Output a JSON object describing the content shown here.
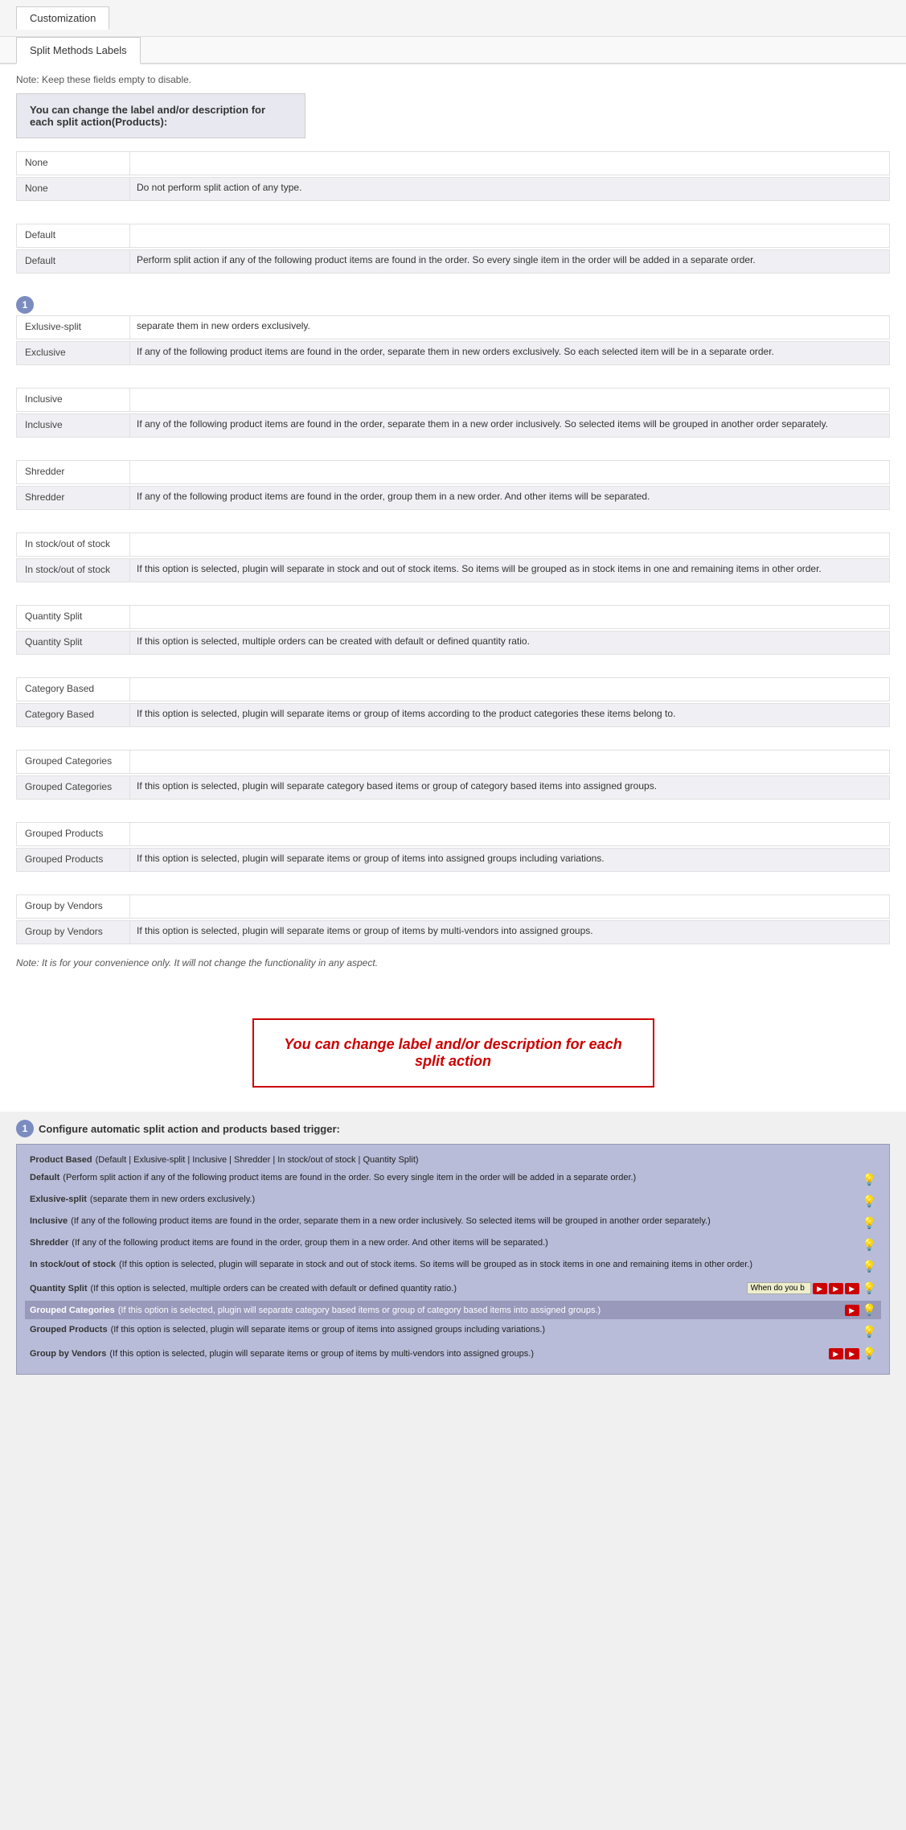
{
  "topNav": {
    "tab": "Customization"
  },
  "subNav": {
    "tab": "Split Methods Labels"
  },
  "note_top": "Note: Keep these fields empty to disable.",
  "infoBox": "You can change the label and/or description for each split action(Products):",
  "groups": [
    {
      "id": "none",
      "label": "None",
      "input_value": "",
      "input_placeholder": "",
      "readonly_label": "None",
      "readonly_desc": "Do not perform split action of any type."
    },
    {
      "id": "default",
      "label": "Default",
      "input_value": "",
      "input_placeholder": "",
      "readonly_label": "Default",
      "readonly_desc": "Perform split action if any of the following product items are found in the order. So every single item in the order will be added in a separate order."
    },
    {
      "id": "exclusive",
      "badge": "1",
      "label": "Exlusive-split",
      "input_value": "separate them in new orders exclusively.",
      "readonly_label": "Exclusive",
      "readonly_desc": "If any of the following product items are found in the order, separate them in new orders exclusively. So each selected item will be in a separate order."
    },
    {
      "id": "inclusive",
      "label": "Inclusive",
      "input_value": "",
      "readonly_label": "Inclusive",
      "readonly_desc": "If any of the following product items are found in the order, separate them in a new order inclusively. So selected items will be grouped in another order separately."
    },
    {
      "id": "shredder",
      "label": "Shredder",
      "input_value": "",
      "readonly_label": "Shredder",
      "readonly_desc": "If any of the following product items are found in the order, group them in a new order. And other items will be separated."
    },
    {
      "id": "instock",
      "label": "In stock/out of stock",
      "input_value": "",
      "readonly_label": "In stock/out of stock",
      "readonly_desc": "If this option is selected, plugin will separate in stock and out of stock items. So items will be grouped as in stock items in one and remaining items in other order."
    },
    {
      "id": "quantity-split",
      "label": "Quantity Split",
      "input_value": "",
      "readonly_label": "Quantity Split",
      "readonly_desc": "If this option is selected, multiple orders can be created with default or defined quantity ratio."
    },
    {
      "id": "category-based",
      "label": "Category Based",
      "input_value": "",
      "readonly_label": "Category Based",
      "readonly_desc": "If this option is selected, plugin will separate items or group of items according to the product categories these items belong to."
    },
    {
      "id": "grouped-categories",
      "label": "Grouped Categories",
      "input_value": "",
      "readonly_label": "Grouped Categories",
      "readonly_desc": "If this option is selected, plugin will separate category based items or group of category based items into assigned groups."
    },
    {
      "id": "grouped-products",
      "label": "Grouped Products",
      "input_value": "",
      "readonly_label": "Grouped Products",
      "readonly_desc": "If this option is selected, plugin will separate items or group of items into assigned groups including variations."
    },
    {
      "id": "group-by-vendors",
      "label": "Group by Vendors",
      "input_value": "",
      "readonly_label": "Group by Vendors",
      "readonly_desc": "If this option is selected, plugin will separate items or group of items by multi-vendors into assigned groups."
    }
  ],
  "note_bottom": "Note: It is for your convenience only. It will not change the functionality in any aspect.",
  "promoText": "You can change label and/or description for each split action",
  "configHeader": "Configure automatic split action and products based trigger:",
  "configBadge": "1",
  "configRows": [
    {
      "id": "product-based",
      "label": "Product Based",
      "desc": "(Default | Exlusive-split | Inclusive | Shredder | In stock/out of stock | Quantity Split)",
      "highlighted": false,
      "actions": []
    },
    {
      "id": "default-config",
      "label": "Default",
      "desc": "(Perform split action if any of the following product items are found in the order. So every single item in the order will be added in a separate order.)",
      "highlighted": false,
      "actions": []
    },
    {
      "id": "exlusive-config",
      "label": "Exlusive-split",
      "desc": "(separate them in new orders exclusively.)",
      "highlighted": false,
      "actions": []
    },
    {
      "id": "inclusive-config",
      "label": "Inclusive",
      "desc": "(If any of the following product items are found in the order, separate them in a new order inclusively. So selected items will be grouped in another order separately.)",
      "highlighted": false,
      "actions": []
    },
    {
      "id": "shredder-config",
      "label": "Shredder",
      "desc": "(If any of the following product items are found in the order, group them in a new order. And other items will be separated.)",
      "highlighted": false,
      "actions": []
    },
    {
      "id": "instock-config",
      "label": "In stock/out of stock",
      "desc": "(If this option is selected, plugin will separate in stock and out of stock items. So items will be grouped as in stock items in one and remaining items in other order.)",
      "highlighted": false,
      "actions": []
    },
    {
      "id": "quantity-config",
      "label": "Quantity Split",
      "desc": "(If this option is selected, multiple orders can be created with default or defined quantity ratio.)",
      "highlighted": false,
      "hasInlineInput": true,
      "inlineInputValue": "When do you b",
      "hasRedBtns": true,
      "actions": [
        "▶",
        "▶",
        "▶"
      ]
    },
    {
      "id": "grouped-cat-config",
      "label": "Grouped Categories",
      "desc": "(If this option is selected, plugin will separate category based items or group of category based items into assigned groups.)",
      "highlighted": true,
      "hasRedBtns": false,
      "actions": [
        "▶"
      ]
    },
    {
      "id": "grouped-prod-config",
      "label": "Grouped Products",
      "desc": "(If this option is selected, plugin will separate items or group of items into assigned groups including variations.)",
      "highlighted": false,
      "actions": []
    },
    {
      "id": "vendors-config",
      "label": "Group by Vendors",
      "desc": "(If this option is selected, plugin will separate items or group of items by multi-vendors into assigned groups.)",
      "highlighted": false,
      "hasRedBtns": true,
      "actions": [
        "▶",
        "▶"
      ]
    }
  ]
}
